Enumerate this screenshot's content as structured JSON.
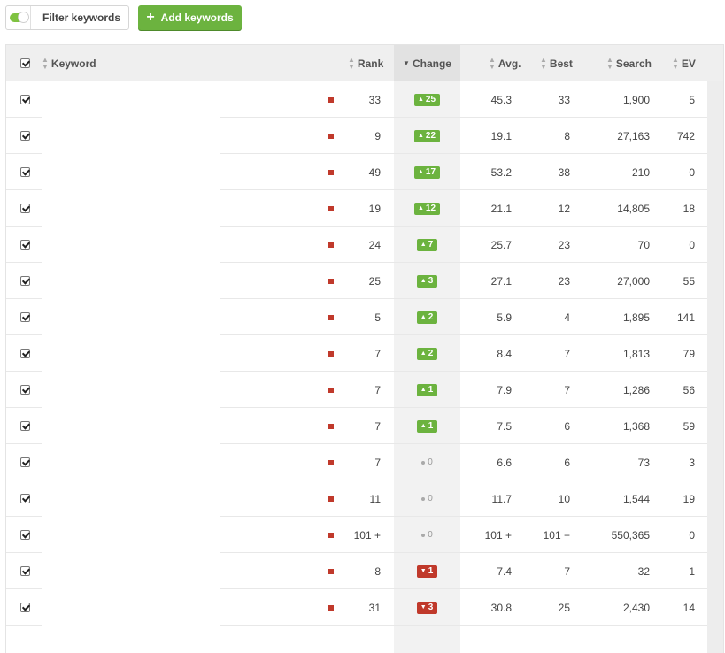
{
  "toolbar": {
    "filter_label": "Filter keywords",
    "add_label": "Add keywords",
    "filter_enabled": true
  },
  "columns": {
    "keyword": "Keyword",
    "rank": "Rank",
    "change": "Change",
    "avg": "Avg.",
    "best": "Best",
    "search": "Search",
    "ev": "EV"
  },
  "sorted_column": "change",
  "colors": {
    "accent_green": "#6cb33f",
    "down_red": "#c0392b"
  },
  "rows": [
    {
      "checked": true,
      "keyword": "",
      "rank": "33",
      "change": "25",
      "dir": "up",
      "avg": "45.3",
      "best": "33",
      "search": "1,900",
      "ev": "5"
    },
    {
      "checked": true,
      "keyword": "",
      "rank": "9",
      "change": "22",
      "dir": "up",
      "avg": "19.1",
      "best": "8",
      "search": "27,163",
      "ev": "742"
    },
    {
      "checked": true,
      "keyword": "",
      "rank": "49",
      "change": "17",
      "dir": "up",
      "avg": "53.2",
      "best": "38",
      "search": "210",
      "ev": "0"
    },
    {
      "checked": true,
      "keyword": "",
      "rank": "19",
      "change": "12",
      "dir": "up",
      "avg": "21.1",
      "best": "12",
      "search": "14,805",
      "ev": "18"
    },
    {
      "checked": true,
      "keyword": "",
      "rank": "24",
      "change": "7",
      "dir": "up",
      "avg": "25.7",
      "best": "23",
      "search": "70",
      "ev": "0"
    },
    {
      "checked": true,
      "keyword": "",
      "rank": "25",
      "change": "3",
      "dir": "up",
      "avg": "27.1",
      "best": "23",
      "search": "27,000",
      "ev": "55"
    },
    {
      "checked": true,
      "keyword": "",
      "rank": "5",
      "change": "2",
      "dir": "up",
      "avg": "5.9",
      "best": "4",
      "search": "1,895",
      "ev": "141"
    },
    {
      "checked": true,
      "keyword": "",
      "rank": "7",
      "change": "2",
      "dir": "up",
      "avg": "8.4",
      "best": "7",
      "search": "1,813",
      "ev": "79"
    },
    {
      "checked": true,
      "keyword": "",
      "rank": "7",
      "change": "1",
      "dir": "up",
      "avg": "7.9",
      "best": "7",
      "search": "1,286",
      "ev": "56"
    },
    {
      "checked": true,
      "keyword": "",
      "rank": "7",
      "change": "1",
      "dir": "up",
      "avg": "7.5",
      "best": "6",
      "search": "1,368",
      "ev": "59"
    },
    {
      "checked": true,
      "keyword": "",
      "rank": "7",
      "change": "0",
      "dir": "none",
      "avg": "6.6",
      "best": "6",
      "search": "73",
      "ev": "3"
    },
    {
      "checked": true,
      "keyword": "",
      "rank": "11",
      "change": "0",
      "dir": "none",
      "avg": "11.7",
      "best": "10",
      "search": "1,544",
      "ev": "19"
    },
    {
      "checked": true,
      "keyword": "",
      "rank": "101 +",
      "change": "0",
      "dir": "none",
      "avg": "101 +",
      "best": "101 +",
      "search": "550,365",
      "ev": "0"
    },
    {
      "checked": true,
      "keyword": "",
      "rank": "8",
      "change": "1",
      "dir": "down",
      "avg": "7.4",
      "best": "7",
      "search": "32",
      "ev": "1"
    },
    {
      "checked": true,
      "keyword": "",
      "rank": "31",
      "change": "3",
      "dir": "down",
      "avg": "30.8",
      "best": "25",
      "search": "2,430",
      "ev": "14"
    }
  ]
}
